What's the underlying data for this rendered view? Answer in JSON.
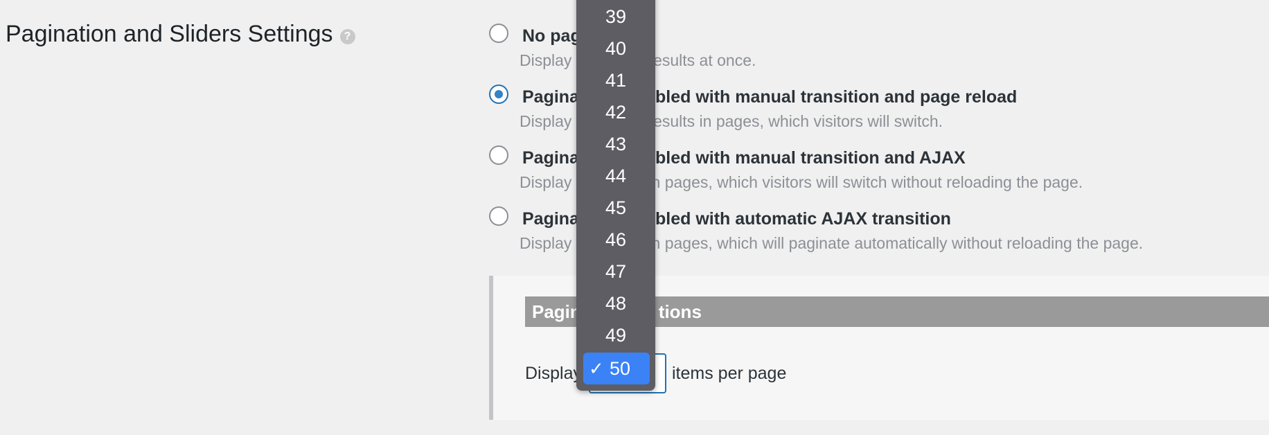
{
  "section": {
    "title": "Pagination and Sliders Settings",
    "help_glyph": "?"
  },
  "options": [
    {
      "label": "No pag",
      "desc": "Display",
      "desc_tail": "results at once.",
      "checked": false
    },
    {
      "label": "Pagina",
      "label_tail": "bled with manual transition and page reload",
      "desc": "Display",
      "desc_tail": "results in pages, which visitors will switch.",
      "checked": true
    },
    {
      "label": "Pagina",
      "label_tail": "bled with manual transition and AJAX",
      "desc": "Display",
      "desc_tail": "in pages, which visitors will switch without reloading the page.",
      "checked": false
    },
    {
      "label": "Pagina",
      "label_tail": "bled with automatic AJAX transition",
      "desc": "Display",
      "desc_tail": "in pages, which will paginate automatically without reloading the page.",
      "checked": false
    }
  ],
  "panel": {
    "header_left": "Pagin",
    "header_right": "tions",
    "per_page_prefix": "Display",
    "per_page_suffix": "items per page"
  },
  "dropdown": {
    "items": [
      "39",
      "40",
      "41",
      "42",
      "43",
      "44",
      "45",
      "46",
      "47",
      "48",
      "49"
    ],
    "selected": "50",
    "check_glyph": "✓"
  }
}
